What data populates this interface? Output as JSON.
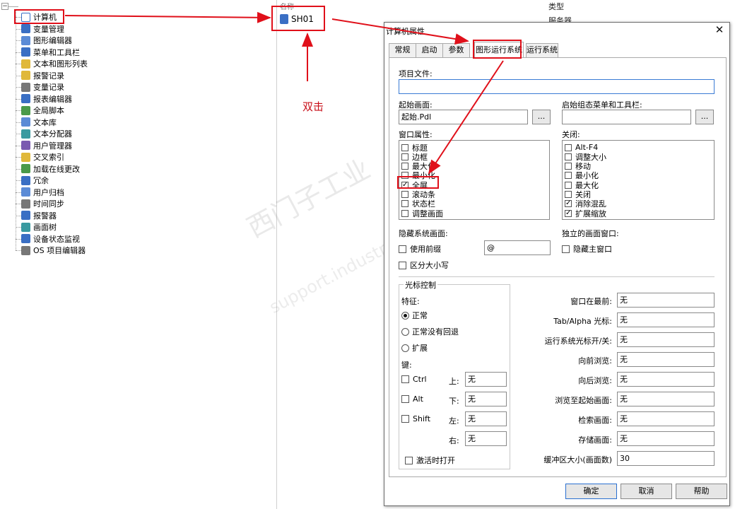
{
  "tree": {
    "root_label": "",
    "items": [
      {
        "label": "计算机",
        "icon": "computer-icon"
      },
      {
        "label": "变量管理",
        "icon": "tag-management-icon"
      },
      {
        "label": "图形编辑器",
        "icon": "graphics-designer-icon"
      },
      {
        "label": "菜单和工具栏",
        "icon": "menu-toolbar-icon"
      },
      {
        "label": "文本和图形列表",
        "icon": "text-graphic-list-icon"
      },
      {
        "label": "报警记录",
        "icon": "alarm-logging-icon"
      },
      {
        "label": "变量记录",
        "icon": "tag-logging-icon"
      },
      {
        "label": "报表编辑器",
        "icon": "report-designer-icon"
      },
      {
        "label": "全局脚本",
        "icon": "global-script-icon"
      },
      {
        "label": "文本库",
        "icon": "text-library-icon"
      },
      {
        "label": "文本分配器",
        "icon": "text-distributor-icon"
      },
      {
        "label": "用户管理器",
        "icon": "user-administrator-icon"
      },
      {
        "label": "交叉索引",
        "icon": "cross-reference-icon"
      },
      {
        "label": "加载在线更改",
        "icon": "load-online-changes-icon"
      },
      {
        "label": "冗余",
        "icon": "redundancy-icon"
      },
      {
        "label": "用户归档",
        "icon": "user-archive-icon"
      },
      {
        "label": "时间同步",
        "icon": "time-sync-icon"
      },
      {
        "label": "报警器",
        "icon": "horn-icon"
      },
      {
        "label": "画面树",
        "icon": "picture-tree-icon"
      },
      {
        "label": "设备状态监视",
        "icon": "device-monitor-icon"
      },
      {
        "label": "OS 项目编辑器",
        "icon": "os-project-editor-icon"
      }
    ]
  },
  "middle": {
    "column_header": "名称",
    "item_label": "SH01"
  },
  "right_columns": {
    "type_header": "类型",
    "type_value": "服务器"
  },
  "annotation": {
    "double_click": "双击"
  },
  "watermark": {
    "line1": "西门子工业",
    "line2": "support.industry.siemens.com/cs"
  },
  "dialog": {
    "title": "计算机属性",
    "close_glyph": "✕",
    "tabs": [
      "常规",
      "启动",
      "参数",
      "图形运行系统",
      "运行系统"
    ],
    "active_tab": "图形运行系统",
    "project_file_label": "项目文件:",
    "project_file_value": "",
    "start_picture_label": "起始画面:",
    "start_picture_value": "起始.Pdl",
    "browse_label": "...",
    "start_config_label": "启始组态菜单和工具栏:",
    "start_config_value": "",
    "window_attr_label": "窗口属性:",
    "window_attrs": [
      {
        "label": "标题",
        "checked": false
      },
      {
        "label": "边框",
        "checked": false
      },
      {
        "label": "最大化",
        "checked": false
      },
      {
        "label": "最小化",
        "checked": false
      },
      {
        "label": "全屏",
        "checked": true
      },
      {
        "label": "滚动条",
        "checked": false
      },
      {
        "label": "状态栏",
        "checked": false
      },
      {
        "label": "调整画面",
        "checked": false
      }
    ],
    "close_label": "关闭:",
    "close_attrs": [
      {
        "label": "Alt-F4",
        "checked": false
      },
      {
        "label": "调整大小",
        "checked": false
      },
      {
        "label": "移动",
        "checked": false
      },
      {
        "label": "最小化",
        "checked": false
      },
      {
        "label": "最大化",
        "checked": false
      },
      {
        "label": "关闭",
        "checked": false
      },
      {
        "label": "消除混乱",
        "checked": true
      },
      {
        "label": "扩展缩放",
        "checked": true
      }
    ],
    "hide_system_label": "隐藏系统画面:",
    "use_prefix_label": "使用前缀",
    "prefix_value": "@",
    "case_sensitive_label": "区分大小写",
    "independent_window_label": "独立的画面窗口:",
    "hide_main_window_label": "隐藏主窗口",
    "cursor_control_label": "光标控制",
    "feature_label": "特征:",
    "radio_normal": "正常",
    "radio_normal_no_rollback": "正常没有回退",
    "radio_extended": "扩展",
    "keys_label": "键:",
    "ctrl_label": "Ctrl",
    "alt_label": "Alt",
    "shift_label": "Shift",
    "up_label": "上:",
    "down_label": "下:",
    "left_label": "左:",
    "right_label": "右:",
    "up_value": "无",
    "down_value": "无",
    "left_value": "无",
    "right_value": "无",
    "activate_open_label": "激活时打开",
    "hotkeys": [
      {
        "label": "窗口在最前:",
        "value": "无"
      },
      {
        "label": "Tab/Alpha 光标:",
        "value": "无"
      },
      {
        "label": "运行系统光标开/关:",
        "value": "无"
      },
      {
        "label": "向前浏览:",
        "value": "无"
      },
      {
        "label": "向后浏览:",
        "value": "无"
      },
      {
        "label": "浏览至起始画面:",
        "value": "无"
      },
      {
        "label": "检索画面:",
        "value": "无"
      },
      {
        "label": "存储画面:",
        "value": "无"
      },
      {
        "label": "缓冲区大小(画面数)",
        "value": "30"
      }
    ],
    "ok_label": "确定",
    "cancel_label": "取消",
    "help_label": "帮助"
  },
  "colors": {
    "highlight": "#e0101a",
    "annotation_text": "#c8101a"
  }
}
